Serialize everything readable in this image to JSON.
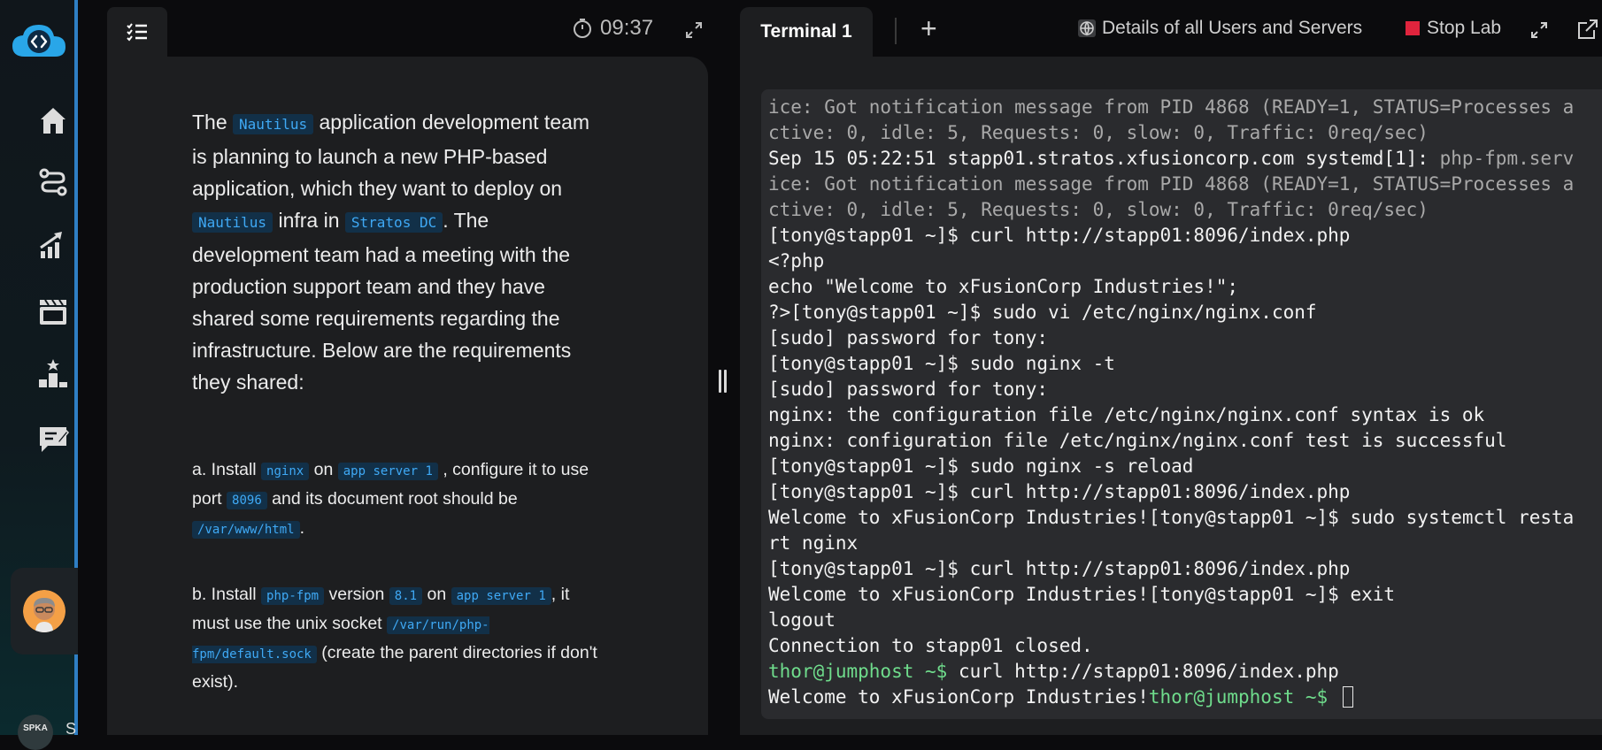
{
  "sidebar": {
    "nav": [
      "home-icon",
      "workflow-icon",
      "progress-icon",
      "clapperboard-icon",
      "leaderboard-icon",
      "feedback-icon"
    ],
    "bottom_badge": "SPKA",
    "bottom_letter": "S"
  },
  "left_panel": {
    "timer": "09:37",
    "intro": {
      "p1": "The",
      "c1": "Nautilus",
      "p2": "application development team is planning to launch a new PHP-based application, which they want to deploy on",
      "c2": "Nautilus",
      "p3": "infra in",
      "c3": "Stratos DC",
      "p4": ". The development team had a meeting with the production support team and they have shared some requirements regarding the infrastructure. Below are the requirements they shared:"
    },
    "req_a": {
      "t1": "a. Install",
      "c1": "nginx",
      "t2": "on",
      "c2": "app server 1",
      "t3": ", configure it to use port",
      "c3": "8096",
      "t4": "and its document root should be",
      "c4": "/var/www/html",
      "t5": "."
    },
    "req_b": {
      "t1": "b. Install",
      "c1": "php-fpm",
      "t2": "version",
      "c2": "8.1",
      "t3": "on",
      "c3": "app server 1",
      "t4": ", it must use the unix socket",
      "c4": "/var/run/php-fpm/default.sock",
      "t5": "(create the parent directories if don't exist)."
    }
  },
  "right_panel": {
    "tab_label": "Terminal 1",
    "details_label": "Details of all Users and Servers",
    "stop_label": "Stop Lab",
    "terminal_lines": [
      {
        "segments": [
          {
            "text": "ice: Got notification message from PID 4868 (READY=1, STATUS=Processes a",
            "style": "dim"
          }
        ]
      },
      {
        "segments": [
          {
            "text": "ctive: 0, idle: 5, Requests: 0, slow: 0, Traffic: 0req/sec)",
            "style": "dim"
          }
        ]
      },
      {
        "segments": [
          {
            "text": "Sep 15 05:22:51 stapp01.stratos.xfusioncorp.com systemd[1]: ",
            "style": "norm"
          },
          {
            "text": "php-fpm.serv",
            "style": "dim"
          }
        ]
      },
      {
        "segments": [
          {
            "text": "ice: Got notification message from PID 4868 (READY=1, STATUS=Processes a",
            "style": "dim"
          }
        ]
      },
      {
        "segments": [
          {
            "text": "ctive: 0, idle: 5, Requests: 0, slow: 0, Traffic: 0req/sec)",
            "style": "dim"
          }
        ]
      },
      {
        "segments": [
          {
            "text": "[tony@stapp01 ~]$ curl http://stapp01:8096/index.php",
            "style": "norm"
          }
        ]
      },
      {
        "segments": [
          {
            "text": "<?php",
            "style": "norm"
          }
        ]
      },
      {
        "segments": [
          {
            "text": "echo \"Welcome to xFusionCorp Industries!\";",
            "style": "norm"
          }
        ]
      },
      {
        "segments": [
          {
            "text": "?>[tony@stapp01 ~]$ sudo vi /etc/nginx/nginx.conf",
            "style": "norm"
          }
        ]
      },
      {
        "segments": [
          {
            "text": "[sudo] password for tony:",
            "style": "norm"
          }
        ]
      },
      {
        "segments": [
          {
            "text": "[tony@stapp01 ~]$ sudo nginx -t",
            "style": "norm"
          }
        ]
      },
      {
        "segments": [
          {
            "text": "[sudo] password for tony:",
            "style": "norm"
          }
        ]
      },
      {
        "segments": [
          {
            "text": "nginx: the configuration file /etc/nginx/nginx.conf syntax is ok",
            "style": "norm"
          }
        ]
      },
      {
        "segments": [
          {
            "text": "nginx: configuration file /etc/nginx/nginx.conf test is successful",
            "style": "norm"
          }
        ]
      },
      {
        "segments": [
          {
            "text": "[tony@stapp01 ~]$ sudo nginx -s reload",
            "style": "norm"
          }
        ]
      },
      {
        "segments": [
          {
            "text": "[tony@stapp01 ~]$ curl http://stapp01:8096/index.php",
            "style": "norm"
          }
        ]
      },
      {
        "segments": [
          {
            "text": "Welcome to xFusionCorp Industries![tony@stapp01 ~]$ sudo systemctl resta",
            "style": "norm"
          }
        ]
      },
      {
        "segments": [
          {
            "text": "rt nginx",
            "style": "norm"
          }
        ]
      },
      {
        "segments": [
          {
            "text": "[tony@stapp01 ~]$ curl http://stapp01:8096/index.php",
            "style": "norm"
          }
        ]
      },
      {
        "segments": [
          {
            "text": "Welcome to xFusionCorp Industries![tony@stapp01 ~]$ exit",
            "style": "norm"
          }
        ]
      },
      {
        "segments": [
          {
            "text": "logout",
            "style": "norm"
          }
        ]
      },
      {
        "segments": [
          {
            "text": "Connection to stapp01 closed.",
            "style": "norm"
          }
        ]
      },
      {
        "segments": [
          {
            "text": "thor@jumphost ~$ ",
            "style": "green"
          },
          {
            "text": "curl http://stapp01:8096/index.php",
            "style": "norm"
          }
        ]
      },
      {
        "segments": [
          {
            "text": "Welcome to xFusionCorp Industries!",
            "style": "norm"
          },
          {
            "text": "thor@jumphost ~$ ",
            "style": "green"
          }
        ],
        "cursor": true
      }
    ]
  },
  "colors": {
    "accent_blue": "#2f7fc4",
    "code_text": "#3fa9f5",
    "prompt_green": "#6fdc8c",
    "stop_red": "#e0243d"
  }
}
